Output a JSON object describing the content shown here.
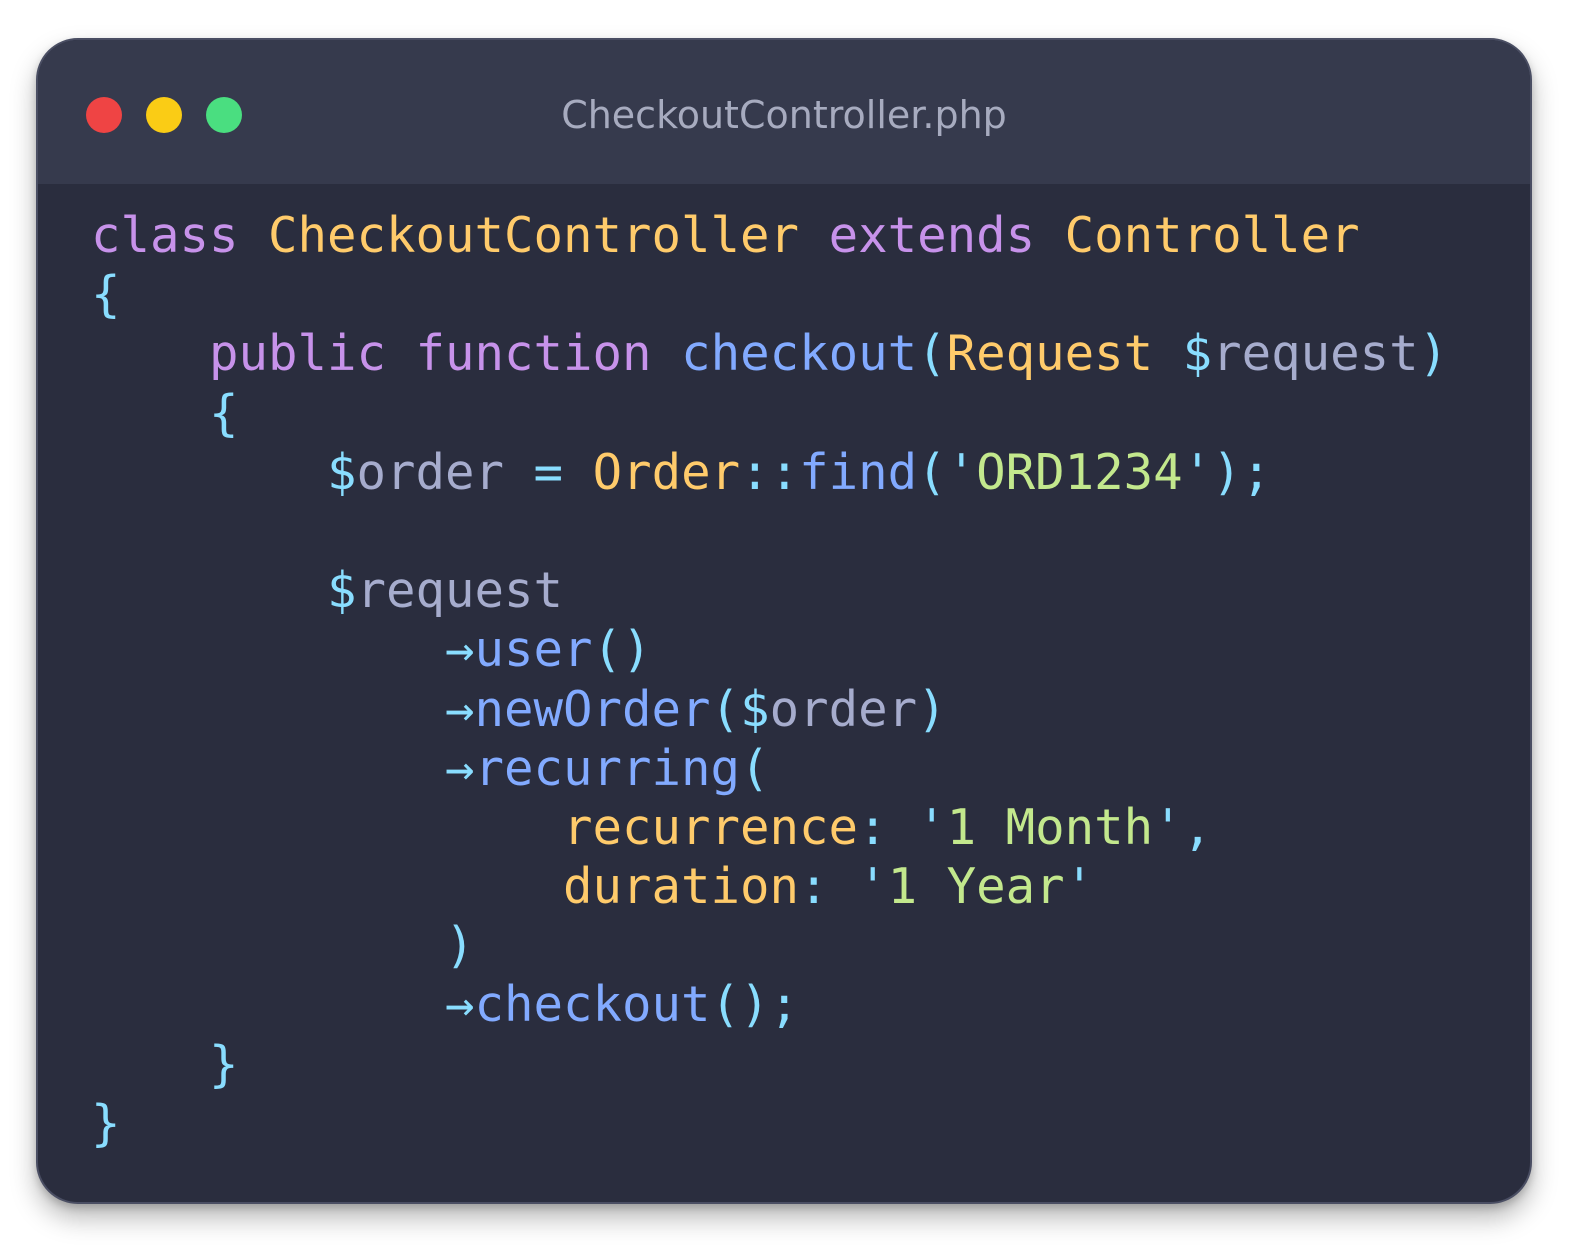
{
  "window": {
    "title": "CheckoutController.php",
    "controls": [
      {
        "name": "close",
        "color": "#ef4444"
      },
      {
        "name": "minimize",
        "color": "#facc15"
      },
      {
        "name": "zoom",
        "color": "#4ade80"
      }
    ]
  },
  "code": {
    "language": "php",
    "l1": {
      "kw_class": "class",
      "class_name": "CheckoutController",
      "kw_extends": "extends",
      "parent": "Controller"
    },
    "l2": {
      "brace": "{"
    },
    "l3": {
      "indent": "    ",
      "kw_public": "public",
      "kw_function": "function",
      "method": "checkout",
      "open": "(",
      "type": "Request",
      "sigil": "$",
      "param": "request",
      "close": ")"
    },
    "l4": {
      "indent": "    ",
      "brace": "{"
    },
    "l5": {
      "indent": "        ",
      "sigil": "$",
      "var": "order",
      "eq": " = ",
      "cls": "Order",
      "sep": "::",
      "fn": "find",
      "open": "(",
      "q1": "'",
      "str": "ORD1234",
      "q2": "'",
      "close": ");"
    },
    "l6": {
      "text": ""
    },
    "l7": {
      "indent": "        ",
      "sigil": "$",
      "var": "request"
    },
    "l8": {
      "indent": "            ",
      "arrow": "→",
      "fn": "user",
      "parens": "()"
    },
    "l9": {
      "indent": "            ",
      "arrow": "→",
      "fn": "newOrder",
      "open": "(",
      "sigil": "$",
      "var": "order",
      "close": ")"
    },
    "l10": {
      "indent": "            ",
      "arrow": "→",
      "fn": "recurring",
      "open": "("
    },
    "l11": {
      "indent": "                ",
      "name": "recurrence",
      "colon": ":",
      "q1": " '",
      "str": "1 Month",
      "q2": "'",
      "comma": ","
    },
    "l12": {
      "indent": "                ",
      "name": "duration",
      "colon": ":",
      "q1": " '",
      "str": "1 Year",
      "q2": "'"
    },
    "l13": {
      "indent": "            ",
      "close": ")"
    },
    "l14": {
      "indent": "            ",
      "arrow": "→",
      "fn": "checkout",
      "close": "();"
    },
    "l15": {
      "indent": "    ",
      "brace": "}"
    },
    "l16": {
      "brace": "}"
    }
  }
}
